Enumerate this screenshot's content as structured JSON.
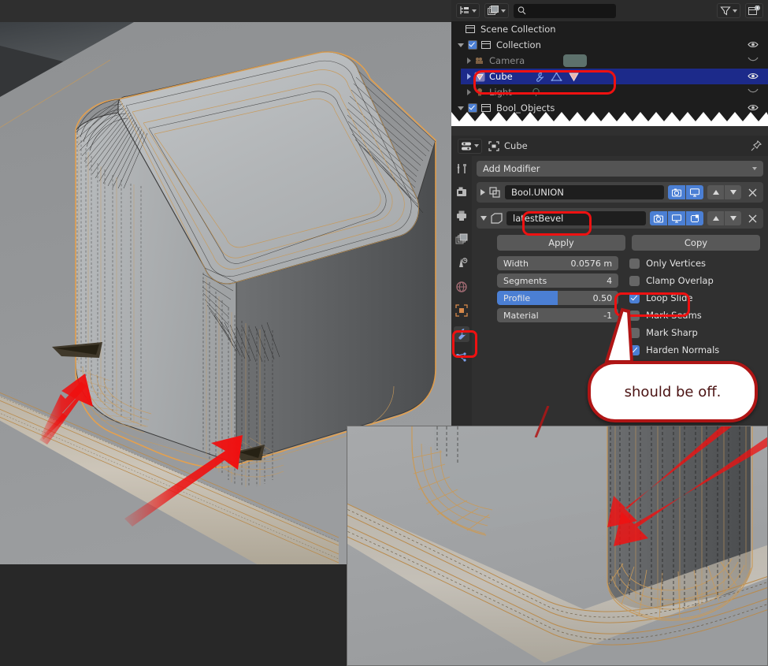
{
  "app": "Blender",
  "outliner": {
    "header": {
      "editor_type_icon": "outliner-icon",
      "display_mode_icon": "view-layer-icon",
      "search_icon": "search-icon",
      "search_value": "",
      "search_placeholder": "",
      "filter_icon": "filter-funnel-icon",
      "new_collection_icon": "new-collection-icon"
    },
    "rows": [
      {
        "label": "Scene Collection",
        "icon": "collection-icon",
        "indent": 0,
        "selected": false,
        "dim": false,
        "disclosure": "none",
        "checkbox": false,
        "visibility": "none"
      },
      {
        "label": "Collection",
        "icon": "collection-icon",
        "indent": 1,
        "selected": false,
        "dim": false,
        "disclosure": "down",
        "checkbox": true,
        "visibility": "eye"
      },
      {
        "label": "Camera",
        "icon": "camera-object-icon",
        "indent": 2,
        "selected": false,
        "dim": true,
        "disclosure": "right",
        "checkbox": false,
        "visibility": "hidden-eye"
      },
      {
        "label": "Cube",
        "icon": "mesh-object-icon",
        "indent": 2,
        "selected": true,
        "dim": false,
        "disclosure": "right",
        "checkbox": false,
        "visibility": "eye",
        "data_icons": [
          "wrench-modifier-icon",
          "mesh-data-icon",
          "mesh-object-data-icon"
        ]
      },
      {
        "label": "Light",
        "icon": "light-object-icon",
        "indent": 2,
        "selected": false,
        "dim": true,
        "disclosure": "right",
        "checkbox": false,
        "visibility": "hidden-eye"
      },
      {
        "label": "Bool_Objects",
        "icon": "collection-icon",
        "indent": 1,
        "selected": false,
        "dim": false,
        "disclosure": "down",
        "checkbox": true,
        "visibility": "eye"
      }
    ]
  },
  "properties": {
    "header": {
      "editor_type_icon": "properties-editor-icon",
      "breadcrumb_icon": "object-icon",
      "breadcrumb_label": "Cube",
      "pin_icon": "pin-icon"
    },
    "tabs": [
      {
        "name": "tool",
        "icon": "tool-screwdriver-wrench-icon",
        "active": false
      },
      {
        "name": "render",
        "icon": "render-camera-back-icon",
        "active": false
      },
      {
        "name": "output",
        "icon": "output-printer-icon",
        "active": false
      },
      {
        "name": "view-layer",
        "icon": "view-layer-images-icon",
        "active": false
      },
      {
        "name": "scene",
        "icon": "scene-cone-icon",
        "active": false
      },
      {
        "name": "world",
        "icon": "world-globe-icon",
        "active": false
      },
      {
        "name": "object",
        "icon": "object-square-icon",
        "active": false
      },
      {
        "name": "modifiers",
        "icon": "wrench-icon",
        "active": true
      },
      {
        "name": "particles",
        "icon": "particles-icon",
        "active": false
      }
    ],
    "add_modifier_label": "Add Modifier",
    "modifiers": [
      {
        "name": "Bool.UNION",
        "type_icon": "boolean-modifier-icon",
        "expanded": false,
        "toggles": [
          {
            "name": "render-toggle",
            "icon": "camera-icon",
            "on": true
          },
          {
            "name": "realtime-toggle",
            "icon": "display-icon",
            "on": true
          }
        ],
        "move_up_icon": "triangle-up-icon",
        "move_down_icon": "triangle-down-icon",
        "delete_icon": "close-x-icon"
      },
      {
        "name": "latestBevel",
        "type_icon": "bevel-modifier-icon",
        "expanded": true,
        "toggles": [
          {
            "name": "render-toggle",
            "icon": "camera-icon",
            "on": true
          },
          {
            "name": "realtime-toggle",
            "icon": "display-icon",
            "on": true
          },
          {
            "name": "edit-mode-toggle",
            "icon": "edit-mode-icon",
            "on": true
          }
        ],
        "move_up_icon": "triangle-up-icon",
        "move_down_icon": "triangle-down-icon",
        "delete_icon": "close-x-icon",
        "apply_label": "Apply",
        "copy_label": "Copy",
        "fields": [
          {
            "label": "Width",
            "value": "0.0576 m",
            "slider_fill": 0
          },
          {
            "label": "Segments",
            "value": "4",
            "slider_fill": 0
          },
          {
            "label": "Profile",
            "value": "0.50",
            "slider_fill": 50
          },
          {
            "label": "Material",
            "value": "-1",
            "slider_fill": 0
          }
        ],
        "checkboxes": [
          {
            "label": "Only Vertices",
            "checked": false
          },
          {
            "label": "Clamp Overlap",
            "checked": false
          },
          {
            "label": "Loop Slide",
            "checked": true
          },
          {
            "label": "Mark Seams",
            "checked": false
          },
          {
            "label": "Mark Sharp",
            "checked": false
          },
          {
            "label": "Harden Normals",
            "checked": true
          }
        ]
      }
    ]
  },
  "annotations": {
    "callout_text": "should be off.",
    "callout_border_color": "#b01515",
    "callout_text_color": "#4a1212",
    "highlight_color": "#ee1111",
    "arrow_color": "#ee1010",
    "highlight_boxes": [
      {
        "name": "cube-row-highlight",
        "target": "outliner-row-cube"
      },
      {
        "name": "modifier-name-highlight",
        "target": "modifier-name-latestBevel"
      },
      {
        "name": "loop-slide-highlight",
        "target": "checkbox-loop-slide"
      },
      {
        "name": "modifier-tab-highlight",
        "target": "properties-tab-modifiers"
      }
    ],
    "arrows": [
      {
        "name": "viewport-arrow-upper-left",
        "points_to": "bevel-artifact-left"
      },
      {
        "name": "viewport-arrow-lower",
        "points_to": "bevel-artifact-right"
      },
      {
        "name": "inset-arrow",
        "points_to": "bevel-artifact-detail"
      }
    ]
  },
  "viewport": {
    "shading": "solid",
    "wireframe_color": "#c89a5a",
    "selection_outline_color": "#e8a04a",
    "background_top": "#3e4246",
    "background_bottom": "#8f9193",
    "object_fill": "#b9bcbe"
  },
  "inset": {
    "name": "zoomed-detail-view",
    "background": "#9a9a9a"
  }
}
